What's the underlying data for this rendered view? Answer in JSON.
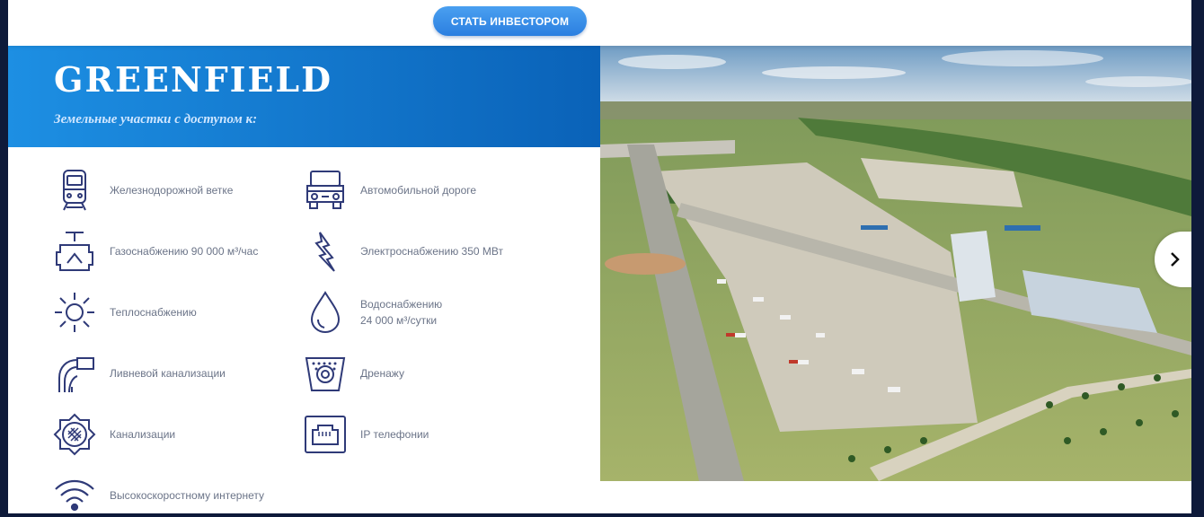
{
  "header": {
    "cta_label": "СТАТЬ ИНВЕСТОРОМ"
  },
  "hero": {
    "title": "GREENFIELD",
    "subtitle": "Земельные участки с доступом к:"
  },
  "features": [
    {
      "icon": "train-icon",
      "label": "Железнодорожной ветке"
    },
    {
      "icon": "truck-icon",
      "label": "Автомобильной дороге"
    },
    {
      "icon": "gas-valve-icon",
      "label": "Газоснабжению 90 000 м³/час"
    },
    {
      "icon": "lightning-icon",
      "label": "Электроснабжению 350 МВт"
    },
    {
      "icon": "sun-icon",
      "label": "Теплоснабжению"
    },
    {
      "icon": "water-drop-icon",
      "label_line1": "Водоснабжению",
      "label_line2": "24 000 м³/сутки"
    },
    {
      "icon": "storm-drain-icon",
      "label": "Ливневой канализации"
    },
    {
      "icon": "drainage-icon",
      "label": "Дренажу"
    },
    {
      "icon": "sewer-icon",
      "label": "Канализации"
    },
    {
      "icon": "ethernet-port-icon",
      "label": "IP телефонии"
    },
    {
      "icon": "wifi-icon",
      "label": "Высокоскоростному интернету"
    }
  ],
  "colors": {
    "icon": "#2f3a78",
    "hero_start": "#1d8fe3",
    "hero_end": "#0a62b8",
    "cta": "#2b7fe0",
    "page_bg": "#0e1a3a"
  }
}
